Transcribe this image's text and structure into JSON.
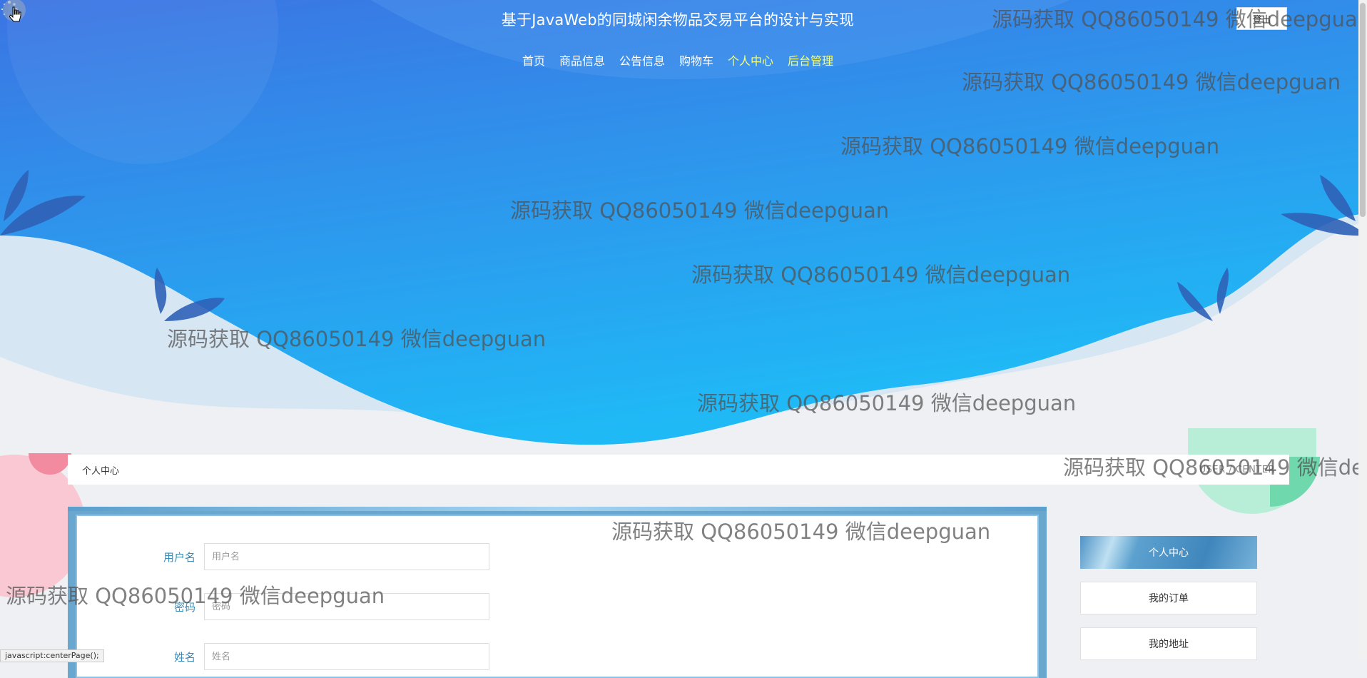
{
  "site": {
    "title": "基于JavaWeb的同城闲余物品交易平台的设计与实现"
  },
  "nav": [
    {
      "label": "首页"
    },
    {
      "label": "商品信息"
    },
    {
      "label": "公告信息"
    },
    {
      "label": "购物车"
    },
    {
      "label": "个人中心"
    },
    {
      "label": "后台管理"
    }
  ],
  "header": {
    "login_label": "登出"
  },
  "breadcrumb": {
    "left": "个人中心",
    "right": "USER / CENTER"
  },
  "form": {
    "fields": [
      {
        "label": "用户名",
        "placeholder": "用户名"
      },
      {
        "label": "密码",
        "placeholder": "密码"
      },
      {
        "label": "姓名",
        "placeholder": "姓名"
      }
    ]
  },
  "side_menu": [
    {
      "label": "个人中心",
      "active": true
    },
    {
      "label": "我的订单",
      "active": false
    },
    {
      "label": "我的地址",
      "active": false
    }
  ],
  "status_bar": "javascript:centerPage();",
  "watermark": "源码获取 QQ86050149 微信deepguan",
  "colors": {
    "hero_top": "#3d7fe6",
    "hero_bottom": "#20b8f5",
    "active_nav": "#f5ff7a",
    "accent": "#3b8bb8"
  }
}
